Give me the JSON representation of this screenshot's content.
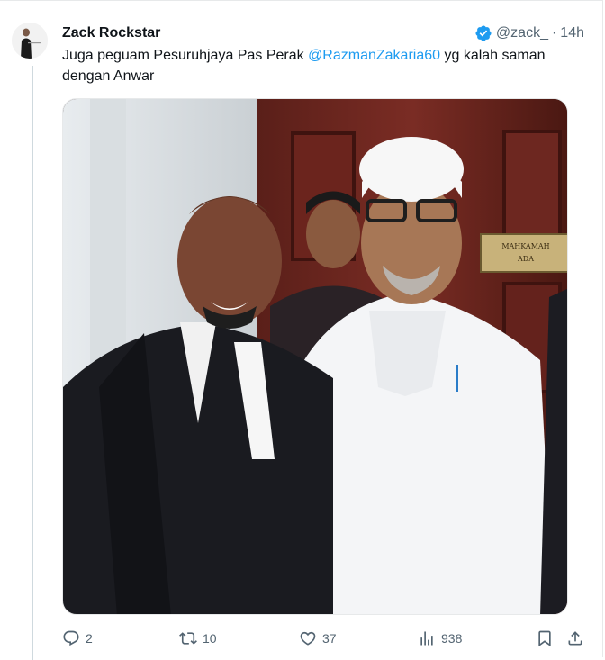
{
  "post": {
    "author": {
      "name": "Zack Rockstar",
      "handle": "@zack_",
      "separator": "·",
      "time": "14h",
      "verified": true,
      "verified_color": "#1d9bf0"
    },
    "text_before": "Juga peguam Pesuruhjaya Pas Perak ",
    "mention": "@RazmanZakaria60",
    "text_after": " yg kalah saman dengan Anwar",
    "media": {
      "sign_text_line1": "MAHKAMAH",
      "sign_text_line2": "ADA"
    },
    "actions": {
      "replies": "2",
      "reposts": "10",
      "likes": "37",
      "views": "938"
    }
  },
  "icons": [
    "verified-badge-icon",
    "reply-icon",
    "repost-icon",
    "like-icon",
    "views-icon",
    "bookmark-icon",
    "share-icon"
  ],
  "colors": {
    "text": "#0f1419",
    "muted": "#536471",
    "link": "#1d9bf0",
    "thread_line": "#cfd9de"
  }
}
